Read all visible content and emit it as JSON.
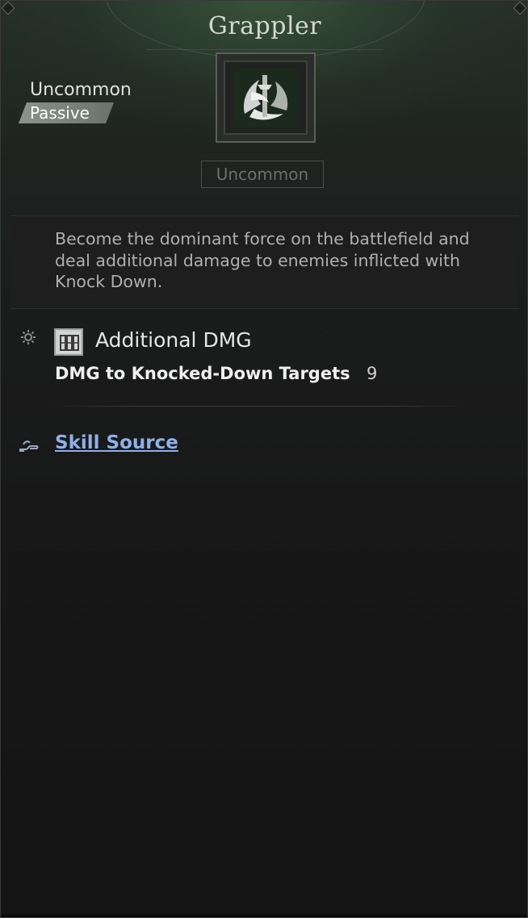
{
  "skill": {
    "name": "Grappler",
    "rarity": "Uncommon",
    "type": "Passive",
    "rarity_badge": "Uncommon",
    "description": "Become the dominant force on the battlefield and deal additional damage to enemies inflicted with Knock Down."
  },
  "effect": {
    "title": "Additional DMG",
    "stat_label": "DMG to Knocked-Down Targets",
    "stat_value": "9"
  },
  "links": {
    "skill_source": "Skill Source"
  },
  "icons": {
    "skill_emblem": "grappler-emblem-icon",
    "effect_gear": "gear-icon",
    "stat": "stat-bars-icon",
    "source": "hand-icon"
  },
  "colors": {
    "accent_green": "#4a6e4a",
    "link_blue": "#8fb0e8",
    "badge_border": "#4c4c4c"
  }
}
